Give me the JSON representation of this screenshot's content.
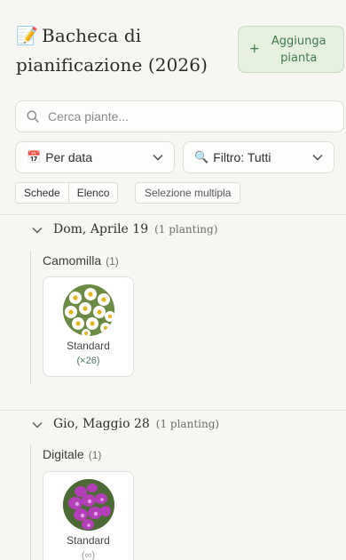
{
  "header": {
    "title_emoji": "📝",
    "title": "Bacheca di pianificazione (2026)",
    "add_button_label": "Aggiunga pianta",
    "add_button_icon": "+"
  },
  "search": {
    "placeholder": "Cerca piante...",
    "value": ""
  },
  "sort_select": {
    "icon": "📅",
    "selected": "Per data"
  },
  "filter_select": {
    "icon": "🔍",
    "selected": "Filtro: Tutti"
  },
  "view_toggle": {
    "options": [
      "Schede",
      "Elenco"
    ]
  },
  "multi_select_label": "Selezione multipla",
  "groups": [
    {
      "date": "Dom, Aprile 19",
      "count_label": "(1 planting)",
      "plants": [
        {
          "name": "Camomilla",
          "count": "(1)",
          "cards": [
            {
              "variety": "Standard",
              "quantity": "(×26)",
              "image_icon": "chamomile-photo"
            }
          ]
        }
      ]
    },
    {
      "date": "Gio, Maggio 28",
      "count_label": "(1 planting)",
      "plants": [
        {
          "name": "Digitale",
          "count": "(1)",
          "cards": [
            {
              "variety": "Standard",
              "quantity": "(∞)",
              "image_icon": "foxglove-photo"
            }
          ]
        }
      ]
    }
  ],
  "colors": {
    "background": "#f7f6f2",
    "accent_green": "#3f7a4b",
    "add_button_bg": "#e6f0df"
  }
}
